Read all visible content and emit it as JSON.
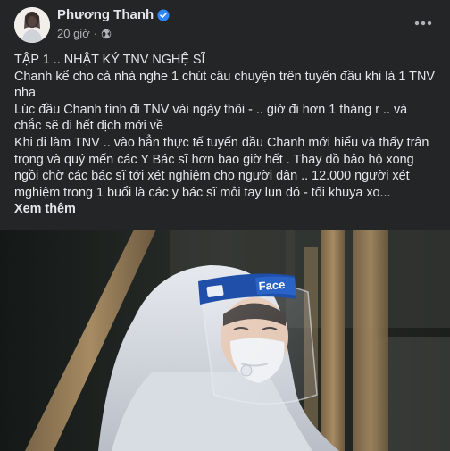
{
  "post": {
    "author": "Phương Thanh",
    "time": "20 giờ",
    "separator": "·",
    "lines": [
      "TẬP 1 .. NHẬT KÝ TNV NGHỆ SĨ",
      "Chanh kể cho cả nhà nghe 1 chút câu chuyện trên tuyến đầu khi là 1 TNV nha",
      "Lúc đầu Chanh tính đi TNV vài ngày thôi - .. giờ đi hơn 1 tháng r .. và chắc sẽ di hết dịch mới về",
      "Khi đi làm TNV .. vào hẳn thực tế tuyến đầu Chanh mới hiểu và thấy trân trọng và quý mến các Y Bác sĩ hơn bao giờ hết . Thay đồ bảo hộ xong ngồi chờ các bác sĩ tới xét nghiệm cho người dân .. 12.000 người xét mghiệm trong 1 buổi là các y bác sĩ mỏi tay lun đó - tối khuya xo..."
    ],
    "see_more": "Xem thêm",
    "face_shield_text": "Face"
  },
  "icons": {
    "verified": "verified-badge-icon",
    "audience": "globe-icon",
    "more": "more-options-icon"
  },
  "colors": {
    "background": "#242526",
    "text_primary": "#e4e6eb",
    "text_secondary": "#b0b3b8",
    "verified_blue": "#2d88ff"
  }
}
